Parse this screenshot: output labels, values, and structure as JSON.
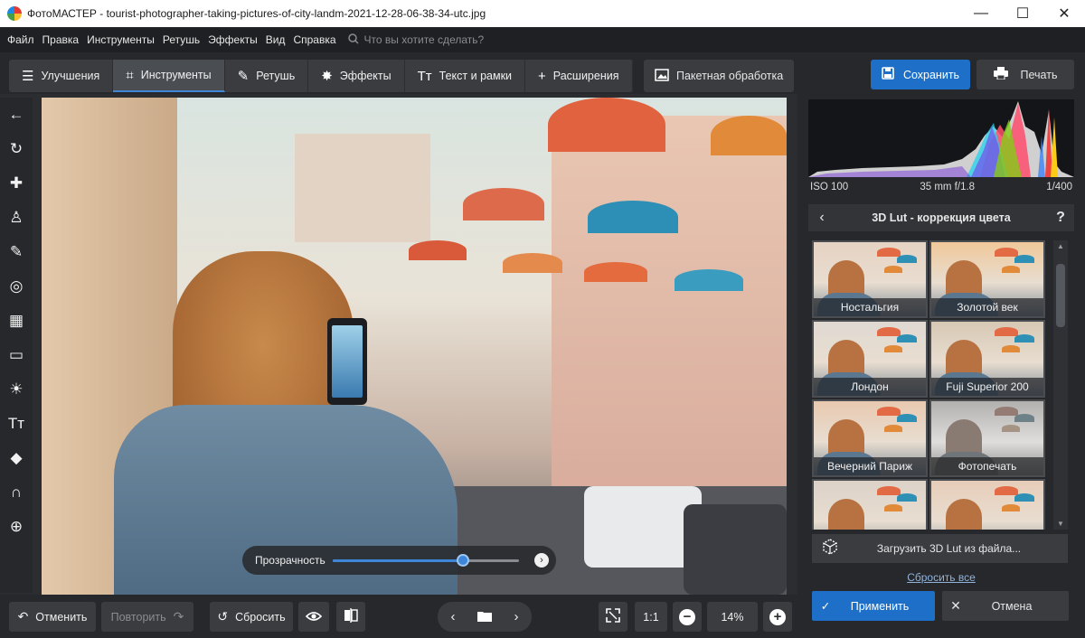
{
  "window": {
    "title": "ФотоМАСТЕР - tourist-photographer-taking-pictures-of-city-landm-2021-12-28-06-38-34-utc.jpg",
    "minimize_glyph": "—",
    "maximize_glyph": "☐",
    "close_glyph": "✕"
  },
  "menu": {
    "items": [
      "Файл",
      "Правка",
      "Инструменты",
      "Ретушь",
      "Эффекты",
      "Вид",
      "Справка"
    ],
    "search_placeholder": "Что вы хотите сделать?"
  },
  "toolbar": {
    "tabs": [
      {
        "label": "Улучшения",
        "icon": "sliders-icon",
        "glyph": "☰",
        "active": false
      },
      {
        "label": "Инструменты",
        "icon": "crop-icon",
        "glyph": "⌗",
        "active": true
      },
      {
        "label": "Ретушь",
        "icon": "brush-icon",
        "glyph": "✎",
        "active": false
      },
      {
        "label": "Эффекты",
        "icon": "magic-wand-icon",
        "glyph": "✸",
        "active": false
      },
      {
        "label": "Текст и рамки",
        "icon": "text-icon",
        "glyph": "Тт",
        "active": false
      },
      {
        "label": "Расширения",
        "icon": "plus-icon",
        "glyph": "+",
        "active": false
      }
    ],
    "batch_label": "Пакетная обработка",
    "save_label": "Сохранить",
    "print_label": "Печать",
    "accent_color": "#1e6fc7"
  },
  "left_tools": [
    {
      "name": "back-arrow-icon",
      "glyph": "←"
    },
    {
      "name": "rotate-icon",
      "glyph": "↻"
    },
    {
      "name": "healing-patch-icon",
      "glyph": "✚"
    },
    {
      "name": "stamp-icon",
      "glyph": "♙"
    },
    {
      "name": "brush-icon",
      "glyph": "✎"
    },
    {
      "name": "radial-filter-icon",
      "glyph": "◎"
    },
    {
      "name": "gradient-filter-icon",
      "glyph": "▦"
    },
    {
      "name": "vignette-icon",
      "glyph": "▭"
    },
    {
      "name": "light-icon",
      "glyph": "☀"
    },
    {
      "name": "text-icon",
      "glyph": "Тт"
    },
    {
      "name": "paint-bucket-icon",
      "glyph": "◆"
    },
    {
      "name": "curves-icon",
      "glyph": "∩"
    },
    {
      "name": "add-tool-icon",
      "glyph": "⊕"
    }
  ],
  "opacity_slider": {
    "label": "Прозрачность",
    "value": 0.7
  },
  "bottom": {
    "undo_label": "Отменить",
    "redo_label": "Повторить",
    "reset_label": "Сбросить",
    "zoom_1to1": "1:1",
    "zoom_level": "14%"
  },
  "histogram": {
    "iso": "ISO 100",
    "lens": "35 mm f/1.8",
    "shutter": "1/400"
  },
  "lut_panel": {
    "title": "3D Lut - коррекция цвета",
    "presets": [
      "Ностальгия",
      "Золотой век",
      "Лондон",
      "Fuji Superior 200",
      "Вечерний Париж",
      "Фотопечать",
      "",
      ""
    ],
    "load_label": "Загрузить 3D Lut из файла...",
    "reset_all_label": "Сбросить все",
    "apply_label": "Применить",
    "cancel_label": "Отмена"
  }
}
